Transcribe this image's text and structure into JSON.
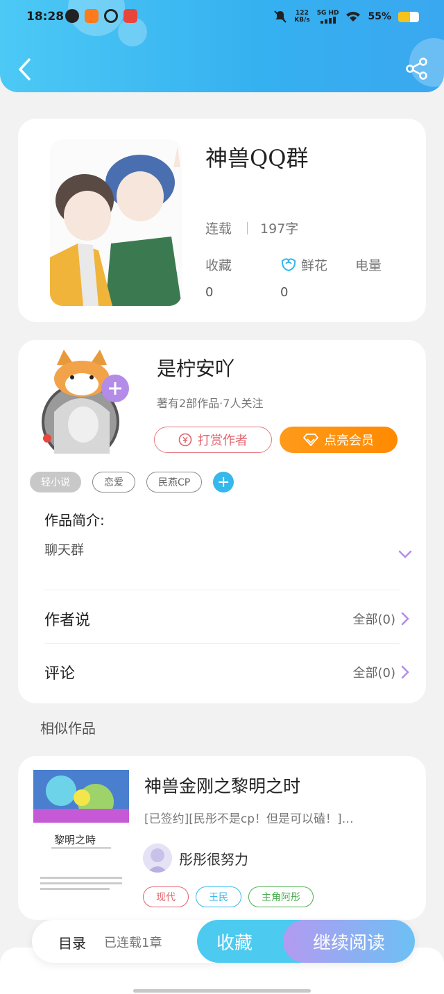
{
  "status_bar": {
    "time": "18:28",
    "net_speed_value": "122",
    "net_speed_unit": "KB/s",
    "network": "5G HD",
    "battery": "55%",
    "battery_level": 0.55
  },
  "header": {
    "back_icon": "chevron-left-icon",
    "share_icon": "share-icon"
  },
  "book": {
    "title": "神兽QQ群",
    "status": "连载",
    "word_count": "197字",
    "stats": [
      {
        "label": "收藏",
        "value": "0"
      },
      {
        "label": "鲜花",
        "value": "0"
      },
      {
        "label": "电量",
        "value": ""
      }
    ]
  },
  "author": {
    "name": "是柠安吖",
    "meta": "著有2部作品·7人关注",
    "tip_button": "打赏作者",
    "vip_button": "点亮会员",
    "tags": [
      "轻小说",
      "恋爱",
      "民燕CP"
    ],
    "add_tag": "+"
  },
  "intro": {
    "label": "作品简介:",
    "text": "聊天群"
  },
  "rows": [
    {
      "label": "作者说",
      "right": "全部(0)"
    },
    {
      "label": "评论",
      "right": "全部(0)"
    }
  ],
  "similar": {
    "section_title": "相似作品",
    "title": "神兽金刚之黎明之时",
    "description": "[已签约][民彤不是cp！但是可以磕！]…",
    "author": "彤彤很努力",
    "cover_title": "黎明之時",
    "tags": [
      {
        "label": "现代",
        "color": "#e0646c"
      },
      {
        "label": "王民",
        "color": "#35b8ec"
      },
      {
        "label": "主角阿彤",
        "color": "#4caf50"
      }
    ]
  },
  "bottom_bar": {
    "toc": "目录",
    "chapters": "已连载1章",
    "favorite": "收藏",
    "continue": "继续阅读"
  },
  "colors": {
    "header": "#3fb8f2",
    "vip": "#ff9010",
    "tip": "#e0646c",
    "tag_add": "#35b8ec",
    "flower_icon": "#35b8ec"
  }
}
